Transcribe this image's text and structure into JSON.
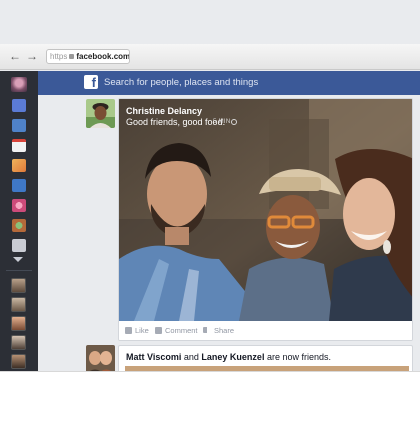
{
  "browser": {
    "back_glyph": "←",
    "forward_glyph": "→",
    "url_protocol": "https",
    "url_host": "facebook.com"
  },
  "header": {
    "logo_letter": "f",
    "search_placeholder": "Search for people, places and things"
  },
  "rail": {
    "icons": [
      "profile-icon",
      "news-feed-icon",
      "messages-icon",
      "events-icon",
      "photos-icon",
      "search-icon",
      "games-icon",
      "music-icon",
      "pages-icon",
      "more-icon"
    ],
    "friend_avatars": 5
  },
  "post": {
    "author": "Christine Delancy",
    "text": "Good friends, good food.",
    "time": "5 MIN",
    "actions": {
      "like": "Like",
      "comment": "Comment",
      "share": "Share"
    }
  },
  "story2": {
    "name_1": "Matt Viscomi",
    "connector": "and",
    "name_2": "Laney Kuenzel",
    "suffix": "are now friends."
  },
  "colors": {
    "brand_blue": "#3b5998",
    "rail_bg": "#2c2f36",
    "feed_bg": "#e9ebee"
  }
}
